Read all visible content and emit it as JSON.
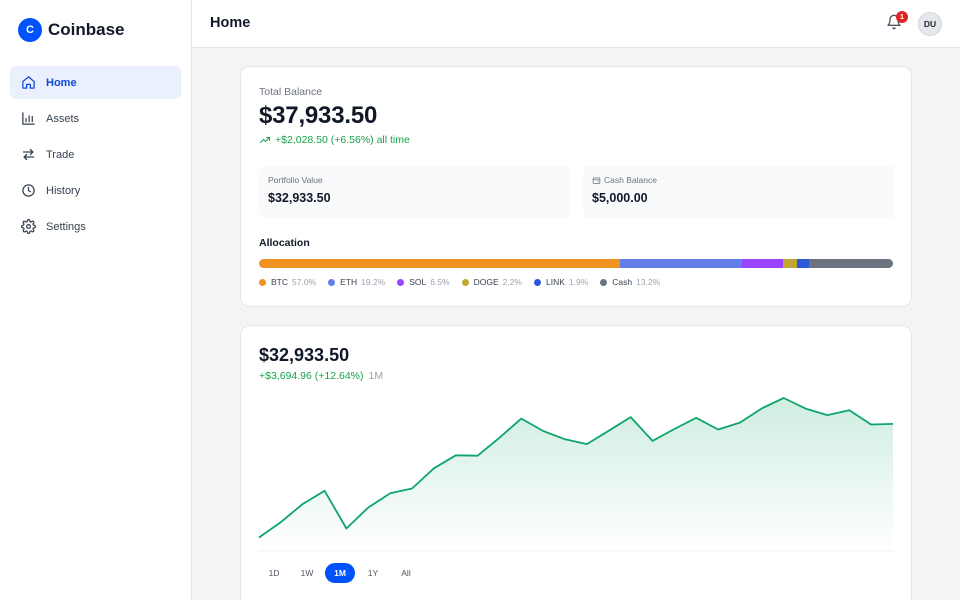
{
  "brand": {
    "logo_letter": "C",
    "name": "Coinbase"
  },
  "nav": [
    {
      "label": "Home",
      "icon": "home-icon",
      "active": true
    },
    {
      "label": "Assets",
      "icon": "bar-chart-icon",
      "active": false
    },
    {
      "label": "Trade",
      "icon": "swap-arrows-icon",
      "active": false
    },
    {
      "label": "History",
      "icon": "clock-icon",
      "active": false
    },
    {
      "label": "Settings",
      "icon": "gear-icon",
      "active": false
    }
  ],
  "header": {
    "title": "Home",
    "notification_count": "1",
    "avatar_initials": "DU"
  },
  "balance": {
    "label": "Total Balance",
    "value": "$37,933.50",
    "change": "+$2,028.50 (+6.56%) all time",
    "portfolio_label": "Portfolio Value",
    "portfolio_value": "$32,933.50",
    "cash_label": "Cash Balance",
    "cash_value": "$5,000.00"
  },
  "allocation": {
    "title": "Allocation",
    "items": [
      {
        "name": "BTC",
        "pct": "57.0%",
        "value": 57.0,
        "color": "#f0921f"
      },
      {
        "name": "ETH",
        "pct": "19.2%",
        "value": 19.2,
        "color": "#627eea"
      },
      {
        "name": "SOL",
        "pct": "6.5%",
        "value": 6.5,
        "color": "#9945ff"
      },
      {
        "name": "DOGE",
        "pct": "2.2%",
        "value": 2.2,
        "color": "#c2a633"
      },
      {
        "name": "LINK",
        "pct": "1.9%",
        "value": 1.9,
        "color": "#2a5ada"
      },
      {
        "name": "Cash",
        "pct": "13.2%",
        "value": 13.2,
        "color": "#6b7280"
      }
    ]
  },
  "portfolio_chart": {
    "value": "$32,933.50",
    "change": "+$3,694.96 (+12.64%)",
    "period": "1M",
    "ranges": [
      "1D",
      "1W",
      "1M",
      "1Y",
      "All"
    ],
    "active_range": "1M"
  },
  "chart_data": {
    "type": "area",
    "title": "",
    "xlabel": "",
    "ylabel": "",
    "color": "#0ea56b",
    "values": [
      29239,
      29741,
      30327,
      30759,
      29532,
      30216,
      30675,
      30833,
      31488,
      31911,
      31898,
      32484,
      33105,
      32703,
      32433,
      32276,
      32710,
      33154,
      32381,
      32768,
      33131,
      32752,
      32976,
      33438,
      33774,
      33431,
      33218,
      33374,
      32912,
      32933
    ],
    "ylim": [
      28800,
      34100
    ]
  },
  "colors": {
    "accent": "#0052ff",
    "positive": "#16a34a"
  }
}
